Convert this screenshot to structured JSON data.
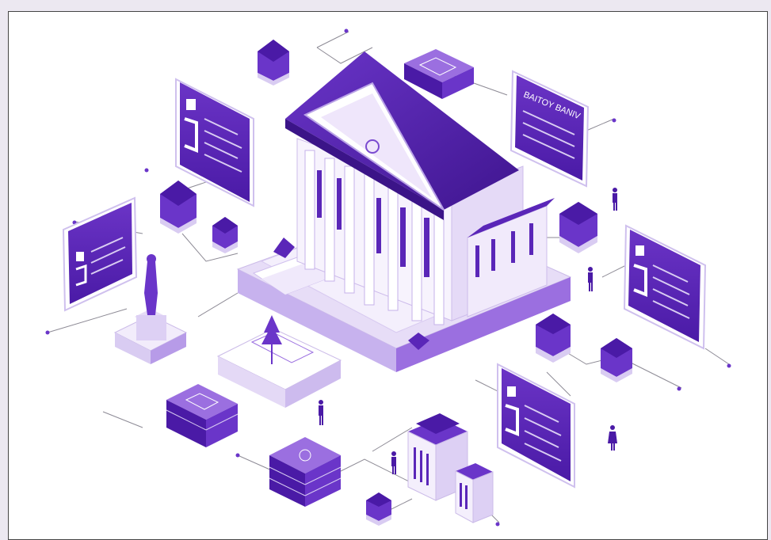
{
  "colors": {
    "deep": "#4a1aa6",
    "mid": "#6a35c9",
    "light": "#9b6fe0",
    "pale": "#d9ccf2",
    "paler": "#efe9fa",
    "line": "#8d8a95"
  },
  "illustration": {
    "building_label": "BAITOY BANIV"
  }
}
